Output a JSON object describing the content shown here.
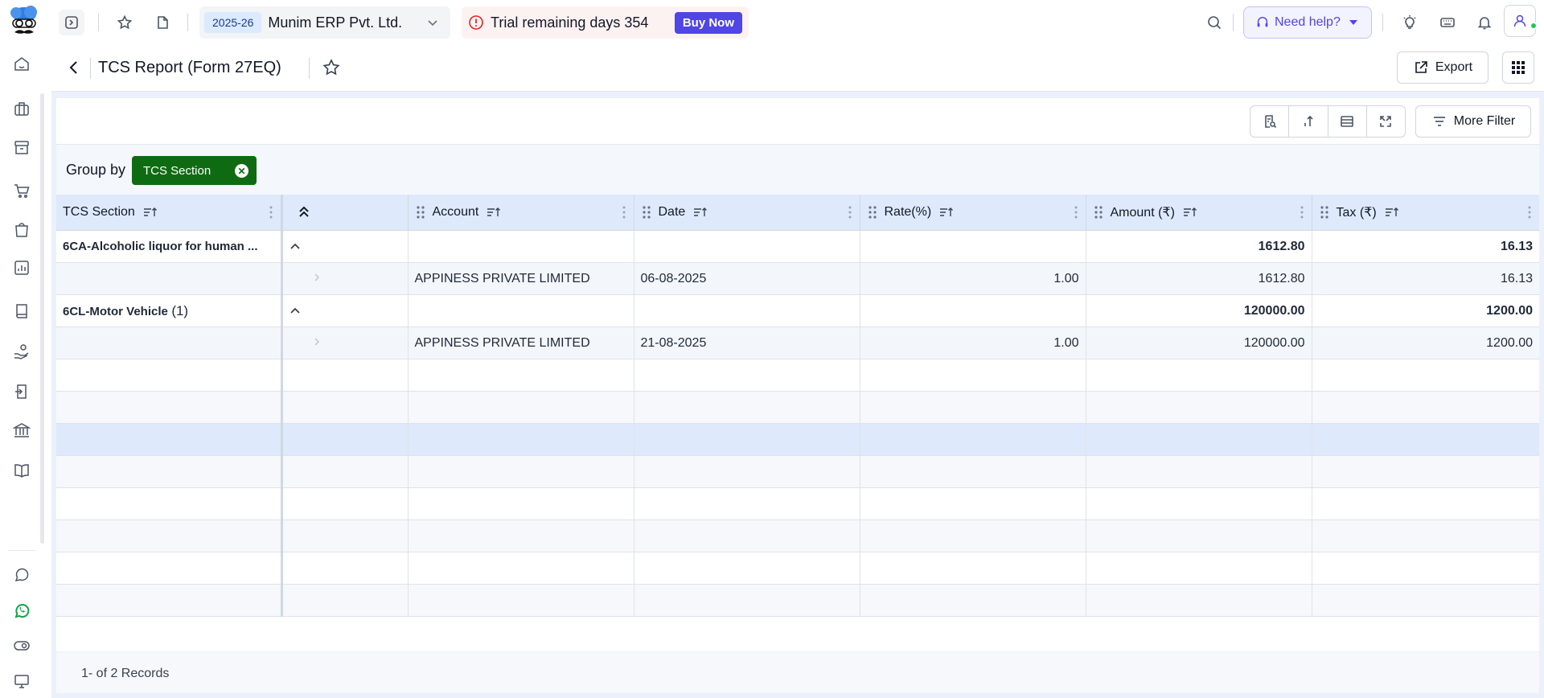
{
  "topbar": {
    "financial_year": "2025-26",
    "company_name": "Munim ERP Pvt. Ltd.",
    "trial_text": "Trial remaining days 354",
    "buy_now_label": "Buy Now",
    "help_label": "Need help?"
  },
  "page": {
    "title": "TCS Report (Form 27EQ)",
    "export_label": "Export"
  },
  "toolbar": {
    "more_filter_label": "More Filter"
  },
  "group_by": {
    "label": "Group by",
    "chip": "TCS Section"
  },
  "table": {
    "columns": [
      "TCS Section",
      "",
      "Account",
      "Date",
      "Rate(%)",
      "Amount (₹)",
      "Tax (₹)"
    ],
    "groups": [
      {
        "name": "6CA-Alcoholic liquor for human ...",
        "count": "",
        "amount_total": "1612.80",
        "tax_total": "16.13",
        "rows": [
          {
            "account": "APPINESS PRIVATE LIMITED",
            "date": "06-08-2025",
            "rate": "1.00",
            "amount": "1612.80",
            "tax": "16.13"
          }
        ]
      },
      {
        "name": "6CL-Motor Vehicle",
        "count": "(1)",
        "amount_total": "120000.00",
        "tax_total": "1200.00",
        "rows": [
          {
            "account": "APPINESS PRIVATE LIMITED",
            "date": "21-08-2025",
            "rate": "1.00",
            "amount": "120000.00",
            "tax": "1200.00"
          }
        ]
      }
    ]
  },
  "footer": {
    "records": "1- of 2 Records"
  },
  "colors": {
    "accent_green": "#0f6b12",
    "brand_indigo": "#4f46e5",
    "header_blue": "#deeafb"
  }
}
